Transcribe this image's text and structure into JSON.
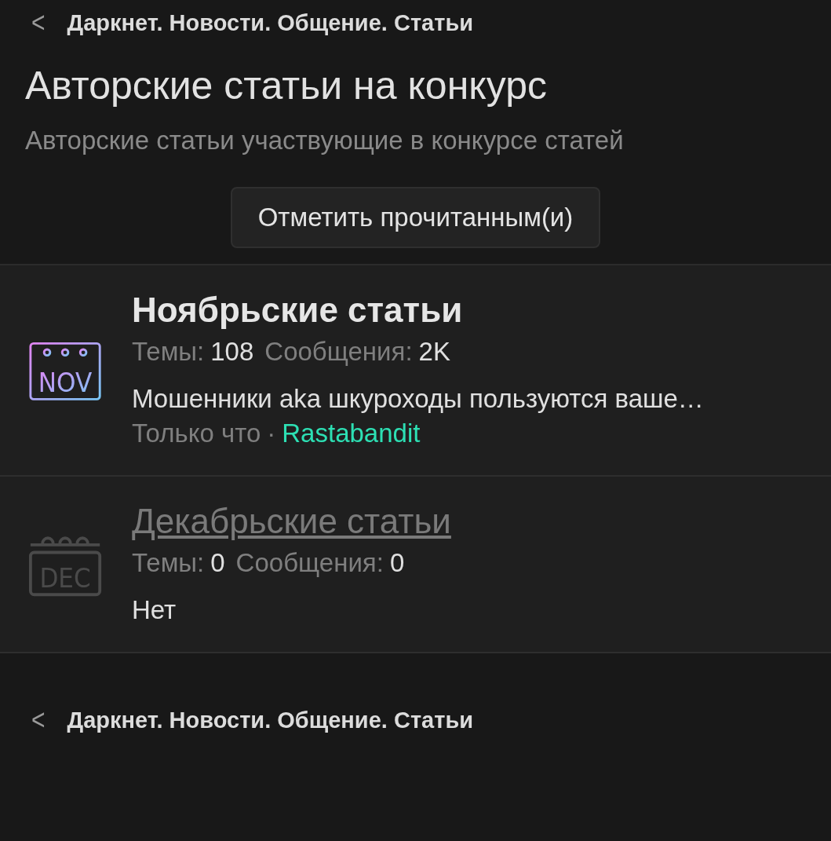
{
  "breadcrumb_top": {
    "back": "<",
    "label": "Даркнет. Новости. Общение. Статьи"
  },
  "title": "Авторские статьи на конкурс",
  "description": "Авторские статьи участвующие в конкурсе статей",
  "mark_read_button": "Отметить прочитанным(и)",
  "forums": [
    {
      "icon_label": "NOV",
      "unread": true,
      "title": "Ноябрьские статьи",
      "threads_label": "Темы:",
      "threads": "108",
      "posts_label": "Сообщения:",
      "posts": "2K",
      "last_post": "Мошенники aka шкуроходы пользуются ваше…",
      "time": "Только что",
      "separator": "·",
      "author": "Rastabandit"
    },
    {
      "icon_label": "DEC",
      "unread": false,
      "title": "Декабрьские статьи",
      "threads_label": "Темы:",
      "threads": "0",
      "posts_label": "Сообщения:",
      "posts": "0",
      "last_post": "Нет"
    }
  ],
  "breadcrumb_bottom": {
    "back": "<",
    "label": "Даркнет. Новости. Общение. Статьи"
  }
}
